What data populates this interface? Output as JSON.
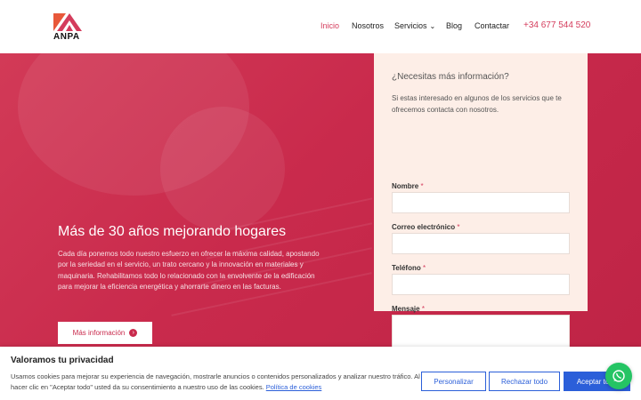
{
  "brand": {
    "logo_text": "ANPA",
    "accent": "#d43c5c",
    "logo_orange": "#e8583a",
    "logo_red": "#d43c5c"
  },
  "nav": {
    "items": [
      "Inicio",
      "Nosotros",
      "Servicios",
      "Blog",
      "Contactar"
    ],
    "servicios_chevron": "⌄",
    "phone": "+34 677 544 520"
  },
  "hero": {
    "title": "Más de 30 años mejorando hogares",
    "text": "Cada día ponemos todo nuestro esfuerzo en ofrecer la máxima calidad, apostando por la seriedad en el servicio, un trato cercano y la innovación en materiales y maquinaria. Rehabilitamos todo lo relacionado con la envolvente de la edificación para mejorar la eficiencia energética y ahorrarte dinero en las facturas.",
    "button_label": "Más información",
    "button_icon": "arrow-right-circle-icon",
    "bg_color": "#c92a4c"
  },
  "form": {
    "title": "¿Necesitas más información?",
    "intro": "Si estas interesado en algunos de los servicios que te ofrecemos contacta con nosotros.",
    "required_mark": "*",
    "fields": [
      {
        "label": "Nombre",
        "value": ""
      },
      {
        "label": "Correo electrónico",
        "value": ""
      },
      {
        "label": "Teléfono",
        "value": ""
      },
      {
        "label": "Mensaje",
        "value": ""
      }
    ]
  },
  "cookie": {
    "title": "Valoramos tu privacidad",
    "text": "Usamos cookies para mejorar su experiencia de navegación, mostrarle anuncios o contenidos personalizados y analizar nuestro tráfico. Al hacer clic en \"Aceptar todo\" usted da su consentimiento a nuestro uso de las cookies.",
    "link": "Política de cookies",
    "buttons": {
      "customize": "Personalizar",
      "reject": "Rechazar todo",
      "accept": "Aceptar todo"
    },
    "button_color": "#2b5fd9"
  },
  "whatsapp": {
    "icon": "whatsapp-icon",
    "color": "#25c464"
  }
}
